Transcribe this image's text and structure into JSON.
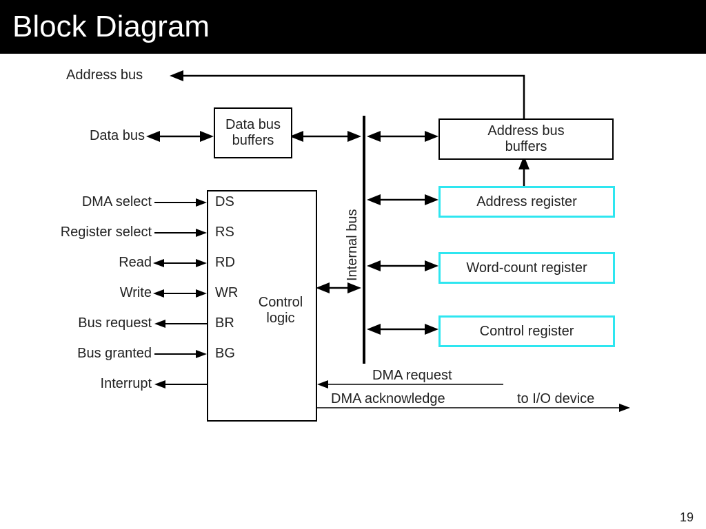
{
  "header": {
    "title": "Block Diagram"
  },
  "labels": {
    "address_bus": "Address bus",
    "data_bus": "Data bus",
    "internal_bus": "Internal bus",
    "dma_select": "DMA select",
    "register_select": "Register select",
    "read": "Read",
    "write": "Write",
    "bus_request": "Bus request",
    "bus_granted": "Bus granted",
    "interrupt": "Interrupt",
    "dma_request": "DMA request",
    "dma_ack": "DMA acknowledge",
    "to_io": "to I/O device"
  },
  "blocks": {
    "data_bus_buffers": "Data bus\nbuffers",
    "address_bus_buffers": "Address bus\nbuffers",
    "address_register": "Address register",
    "word_count_register": "Word-count register",
    "control_register": "Control register",
    "control_logic": "Control\nlogic"
  },
  "pins": {
    "ds": "DS",
    "rs": "RS",
    "rd": "RD",
    "wr": "WR",
    "br": "BR",
    "bg": "BG"
  },
  "page_number": "19"
}
